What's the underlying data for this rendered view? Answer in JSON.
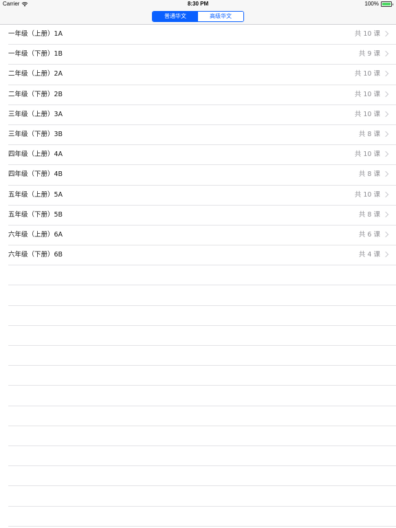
{
  "status_bar": {
    "carrier": "Carrier",
    "time": "8:30 PM",
    "battery": "100%"
  },
  "segmented_control": {
    "options": [
      "普通华文",
      "高级华文"
    ],
    "selected": "普通华文"
  },
  "lessons": [
    {
      "title": "一年级（上册）1A",
      "count": "共 10 课"
    },
    {
      "title": "一年级（下册）1B",
      "count": "共 9 课"
    },
    {
      "title": "二年级（上册）2A",
      "count": "共 10 课"
    },
    {
      "title": "二年级（下册）2B",
      "count": "共 10 课"
    },
    {
      "title": "三年级（上册）3A",
      "count": "共 10 课"
    },
    {
      "title": "三年级（下册）3B",
      "count": "共 8 课"
    },
    {
      "title": "四年级（上册）4A",
      "count": "共 10 课"
    },
    {
      "title": "四年级（下册）4B",
      "count": "共 8 课"
    },
    {
      "title": "五年级（上册）5A",
      "count": "共 10 课"
    },
    {
      "title": "五年级（下册）5B",
      "count": "共 8 课"
    },
    {
      "title": "六年级（上册）6A",
      "count": "共 6 课"
    },
    {
      "title": "六年级（下册）6B",
      "count": "共 4 课"
    }
  ],
  "colors": {
    "accent": "#0a60ff",
    "secondary_text": "#8e8e93",
    "separator": "#e3e3e6"
  },
  "icons": [
    "wifi-icon",
    "battery-icon",
    "chevron-right-icon"
  ]
}
